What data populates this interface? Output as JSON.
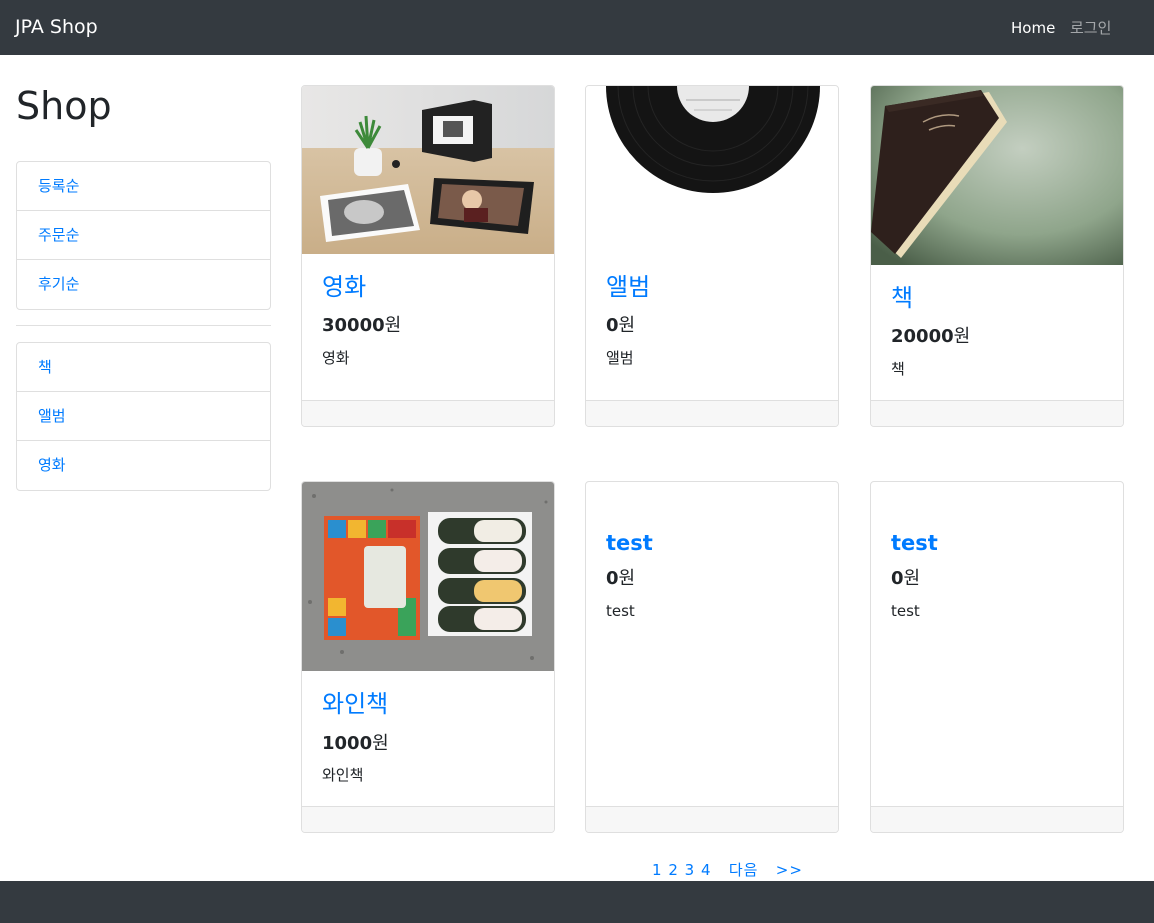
{
  "navbar": {
    "brand": "JPA Shop",
    "links": [
      {
        "label": "Home"
      },
      {
        "label": "로그인"
      }
    ]
  },
  "sidebar": {
    "title": "Shop",
    "sort_items": [
      {
        "label": "등록순"
      },
      {
        "label": "주문순"
      },
      {
        "label": "후기순"
      }
    ],
    "category_items": [
      {
        "label": "책"
      },
      {
        "label": "앨범"
      },
      {
        "label": "영화"
      }
    ]
  },
  "products": [
    {
      "title": "영화",
      "price": "30000",
      "currency": "원",
      "desc": "영화",
      "image": "movie-photo-album"
    },
    {
      "title": "앨범",
      "price": "0",
      "currency": "원",
      "desc": "앨범",
      "image": "vinyl-record"
    },
    {
      "title": "책",
      "price": "20000",
      "currency": "원",
      "desc": "책",
      "image": "old-book"
    },
    {
      "title": "와인책",
      "price": "1000",
      "currency": "원",
      "desc": "와인책",
      "image": "wine-gift-box"
    },
    {
      "title": "test",
      "price": "0",
      "currency": "원",
      "desc": "test"
    },
    {
      "title": "test",
      "price": "0",
      "currency": "원",
      "desc": "test"
    }
  ],
  "pagination": {
    "pages": [
      "1",
      "2",
      "3",
      "4"
    ],
    "next_label": "다음",
    "last_label": ">>"
  },
  "colors": {
    "navbar": "#343a40",
    "link": "#007bff",
    "border": "#dfdfdf"
  }
}
